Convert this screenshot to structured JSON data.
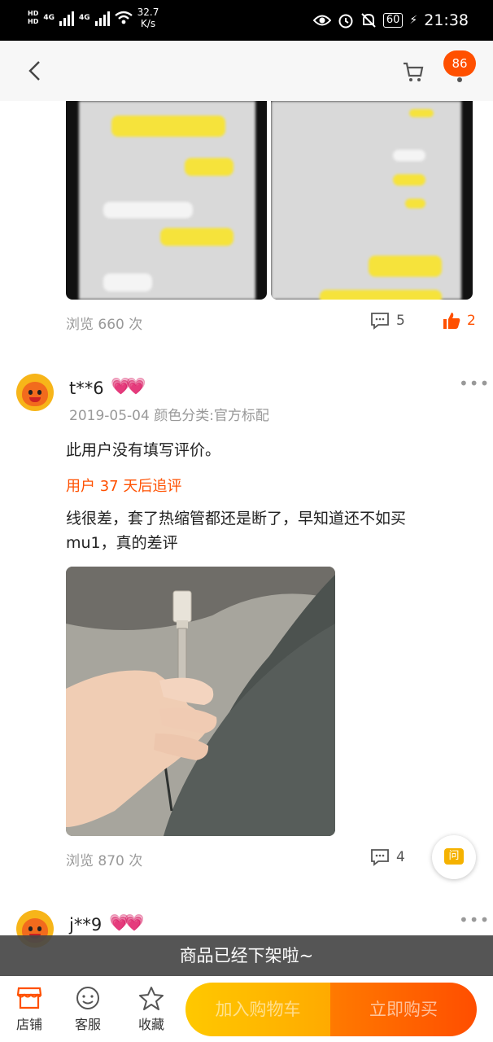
{
  "status_bar": {
    "network_a": "4G",
    "network_b": "4G",
    "speed_value": "32.7",
    "speed_unit": "K/s",
    "battery": "60",
    "time": "21:38"
  },
  "nav": {
    "cart_badge": "86"
  },
  "review_prev": {
    "views": "浏览 660 次",
    "comments": "5",
    "likes": "2"
  },
  "review1": {
    "username": "t**6",
    "date_variant": "2019-05-04 颜色分类:官方标配",
    "text": "此用户没有填写评价。",
    "followup_label": "用户 37 天后追评",
    "followup_text": "线很差，套了热缩管都还是断了，早知道还不如买mu1，真的差评",
    "views": "浏览 870 次",
    "comments": "4"
  },
  "review2": {
    "username": "j**9"
  },
  "ask_button": "问",
  "toast": "商品已经下架啦~",
  "bottom_bar": {
    "store": "店铺",
    "service": "客服",
    "favorite": "收藏",
    "add_to_cart": "加入购物车",
    "buy_now": "立即购买"
  },
  "colors": {
    "accent": "#ff5000",
    "cart_button": "#ffb800",
    "buy_button": "#ff5a00"
  }
}
